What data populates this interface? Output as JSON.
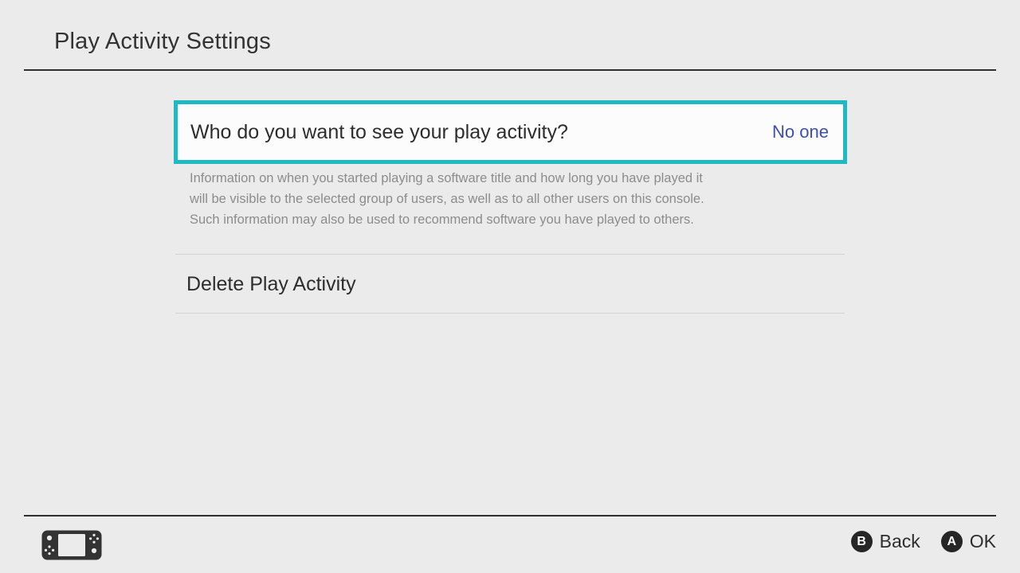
{
  "header": {
    "title": "Play Activity Settings"
  },
  "main": {
    "setting": {
      "label": "Who do you want to see your play activity?",
      "value": "No one",
      "description_lines": [
        "Information on when you started playing a software title and how long you have played it",
        "will be visible to the selected group of users, as well as to all other users on this console.",
        "Such information may also be used to recommend software you have played to others."
      ]
    },
    "delete_row": {
      "label": "Delete Play Activity"
    }
  },
  "footer": {
    "console_icon": "nintendo-switch-console-icon",
    "hints": [
      {
        "button": "B",
        "label": "Back"
      },
      {
        "button": "A",
        "label": "OK"
      }
    ]
  },
  "colors": {
    "background": "#ebebeb",
    "highlight_border": "#1fb9c4",
    "highlight_fill": "#fcfcfc",
    "value_link": "#3f4fb0",
    "rule": "#2f2f2f",
    "separator": "#d2d2d2",
    "description_text": "#8c8c8c",
    "badge": "#262626"
  }
}
